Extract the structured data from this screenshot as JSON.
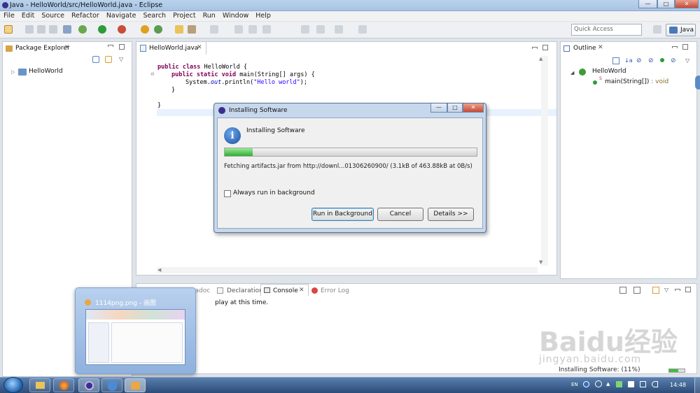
{
  "window": {
    "title": "Java - HelloWorld/src/HelloWorld.java - Eclipse",
    "min_label": "—",
    "max_label": "□",
    "close_label": "✕"
  },
  "menu": [
    "File",
    "Edit",
    "Source",
    "Refactor",
    "Navigate",
    "Search",
    "Project",
    "Run",
    "Window",
    "Help"
  ],
  "toolbar": {
    "quick_access_placeholder": "Quick Access",
    "perspective_label": "Java"
  },
  "package_explorer": {
    "tab_label": "Package Explorer",
    "project": "HelloWorld"
  },
  "editor": {
    "tab_label": "HelloWorld.java",
    "lines": {
      "l1_kw": "public class",
      "l1_rest": " HelloWorld {",
      "l2_kw": "public static void",
      "l2_rest": " main(String[] args) {",
      "l3_pre": "System.",
      "l3_out": "out",
      "l3_mid": ".println(",
      "l3_str": "\"Hello world\"",
      "l3_end": ");",
      "l4": "}",
      "l5": "}"
    }
  },
  "outline": {
    "tab_label": "Outline",
    "class_name": "HelloWorld",
    "method": "main(String[])",
    "method_type": " : void",
    "static_marker": "S"
  },
  "bottom_panel": {
    "tabs": [
      "Javadoc",
      "Declaration",
      "Console",
      "Error Log"
    ],
    "message_visible": "play at this time."
  },
  "dialog": {
    "title": "Installing Software",
    "heading": "Installing Software",
    "progress_percent": 11,
    "status": "Fetching artifacts.jar from http://downl...01306260900/ (3.1kB of 463.88kB at 0B/s)",
    "checkbox_label": "Always run in background",
    "checkbox_checked": false,
    "buttons": {
      "run_bg": "Run in Background",
      "cancel": "Cancel",
      "details": "Details >>"
    }
  },
  "status_bar": {
    "text": "Installing Software: (11%)"
  },
  "taskbar": {
    "preview_title": "1114png.png - 画图",
    "tray_lang": "EN",
    "clock": "14:48"
  },
  "watermark": {
    "text": "Baidu经验",
    "sub": "jingyan.baidu.com"
  }
}
